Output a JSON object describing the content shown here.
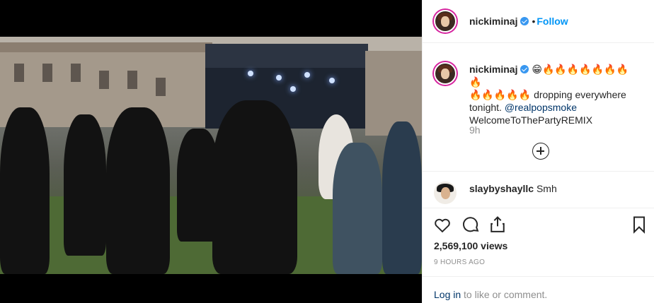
{
  "post": {
    "username": "nickiminaj",
    "follow_label": "Follow",
    "separator": "•"
  },
  "caption": {
    "username": "nickiminaj",
    "emoji_line": "😁🔥🔥🔥🔥🔥🔥🔥🔥",
    "fire_line": "🔥🔥🔥🔥🔥",
    "text_1": "dropping everywhere tonight.",
    "mention": "@realpopsmoke",
    "text_2": "WelcomeToTheParty",
    "text_3": "REMIX",
    "age": "9h"
  },
  "comment": {
    "username": "slaybyshayllc",
    "text": "Smh"
  },
  "stats": {
    "views": "2,569,100 views",
    "time_ago": "9 HOURS AGO"
  },
  "footer": {
    "login_link": "Log in",
    "login_rest": " to like or comment."
  },
  "icons": {
    "like": "heart-icon",
    "comment": "comment-icon",
    "share": "share-icon",
    "save": "bookmark-icon",
    "add": "plus-circle-icon"
  },
  "colors": {
    "link_blue": "#0095f6",
    "verified_blue": "#3897f0",
    "muted": "#8e8e8e",
    "text": "#262626"
  }
}
